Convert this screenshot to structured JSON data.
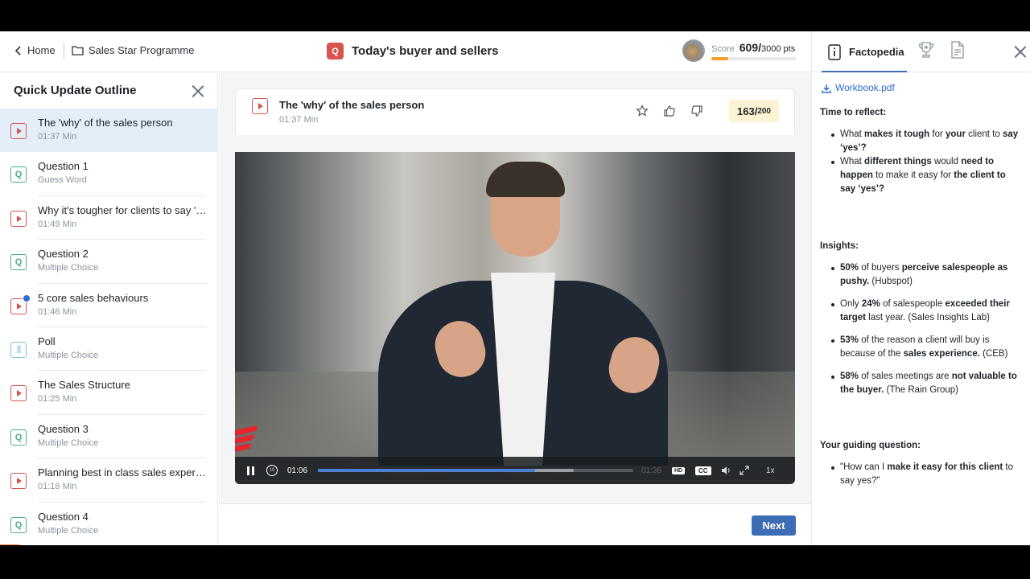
{
  "breadcrumb": {
    "home": "Home",
    "programme": "Sales Star Programme"
  },
  "header": {
    "badge": "Q",
    "title": "Today's buyer and sellers"
  },
  "score": {
    "label": "Score",
    "value": "609/",
    "max": "3000 pts",
    "progress_fraction": 0.2
  },
  "outline": {
    "title": "Quick Update Outline",
    "items": [
      {
        "type": "video",
        "title": "The 'why' of the sales person",
        "sub": "01:37 Min",
        "active": true
      },
      {
        "type": "question",
        "title": "Question 1",
        "sub": "Guess Word"
      },
      {
        "type": "video",
        "title": "Why it's tougher for clients to say 'y...",
        "sub": "01:49 Min"
      },
      {
        "type": "question",
        "title": "Question 2",
        "sub": "Multiple Choice"
      },
      {
        "type": "video",
        "title": "5 core sales behaviours",
        "sub": "01:46 Min",
        "completed": true
      },
      {
        "type": "poll",
        "title": "Poll",
        "sub": "Multiple Choice"
      },
      {
        "type": "video",
        "title": "The Sales Structure",
        "sub": "01:25 Min"
      },
      {
        "type": "question",
        "title": "Question 3",
        "sub": "Multiple Choice"
      },
      {
        "type": "video",
        "title": "Planning best in class sales experie...",
        "sub": "01:18 Min"
      },
      {
        "type": "question",
        "title": "Question 4",
        "sub": "Multiple Choice"
      }
    ]
  },
  "lesson": {
    "title": "The 'why' of the sales person",
    "duration": "01:37 Min",
    "points": "163/",
    "points_max": "200"
  },
  "player": {
    "current_time": "01:06",
    "total_time": "01:36",
    "played_fraction": 0.69,
    "buffered_fraction": 0.81,
    "hd": "HD",
    "cc": "CC",
    "speed": "1x"
  },
  "footer": {
    "next_label": "Next"
  },
  "factopedia": {
    "tab_label": "Factopedia",
    "workbook": "Workbook.pdf",
    "reflect_title": "Time to reflect:",
    "reflect_items": [
      [
        {
          "t": "What "
        },
        {
          "t": "makes it tough",
          "b": true
        },
        {
          "t": " for "
        },
        {
          "t": "your",
          "b": true
        },
        {
          "t": " client to "
        },
        {
          "t": "say ‘yes’?",
          "b": true
        }
      ],
      [
        {
          "t": "What "
        },
        {
          "t": "different things",
          "b": true
        },
        {
          "t": " would "
        },
        {
          "t": "need to happen",
          "b": true
        },
        {
          "t": " to make it easy for "
        },
        {
          "t": "the client to say ‘yes’?",
          "b": true
        }
      ]
    ],
    "insights_title": "Insights:",
    "insights_items": [
      [
        {
          "t": "50%",
          "b": true
        },
        {
          "t": " of buyers "
        },
        {
          "t": "perceive salespeople as pushy.",
          "b": true
        },
        {
          "t": " (Hubspot)"
        }
      ],
      [
        {
          "t": "Only "
        },
        {
          "t": "24%",
          "b": true
        },
        {
          "t": " of salespeople "
        },
        {
          "t": "exceeded their target",
          "b": true
        },
        {
          "t": " last year. (Sales Insights Lab)"
        }
      ],
      [
        {
          "t": "53%",
          "b": true
        },
        {
          "t": " of the reason a client will buy is because of the "
        },
        {
          "t": "sales experience.",
          "b": true
        },
        {
          "t": " (CEB)"
        }
      ],
      [
        {
          "t": "58%",
          "b": true
        },
        {
          "t": " of sales meetings are "
        },
        {
          "t": "not valuable to the buyer.",
          "b": true
        },
        {
          "t": " (The Rain Group)"
        }
      ]
    ],
    "guiding_title": "Your guiding question:",
    "guiding_items": [
      [
        {
          "t": "\"How can I "
        },
        {
          "t": "make it easy for this client",
          "b": true
        },
        {
          "t": " to say yes?\""
        }
      ]
    ]
  },
  "colors": {
    "accent": "#3d6db5",
    "video_icon": "#d9534f",
    "question_icon": "#4caf86",
    "score_bar": "#f0a02a",
    "active_row": "#e3eef9"
  }
}
